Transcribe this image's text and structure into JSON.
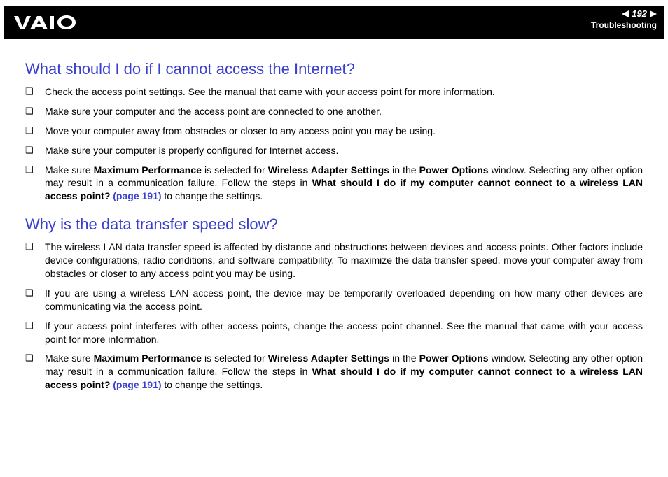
{
  "header": {
    "page_number": "192",
    "section": "Troubleshooting"
  },
  "section1": {
    "heading": "What should I do if I cannot access the Internet?",
    "items": [
      {
        "text": "Check the access point settings. See the manual that came with your access point for more information."
      },
      {
        "text": "Make sure your computer and the access point are connected to one another."
      },
      {
        "text": "Move your computer away from obstacles or closer to any access point you may be using."
      },
      {
        "text": "Make sure your computer is properly configured for Internet access."
      }
    ],
    "item5": {
      "p1": "Make sure ",
      "b1": "Maximum Performance",
      "p2": " is selected for ",
      "b2": "Wireless Adapter Settings",
      "p3": " in the ",
      "b3": "Power Options",
      "p4": " window. Selecting any other option may result in a communication failure. Follow the steps in ",
      "b4": "What should I do if my computer cannot connect to a wireless LAN access point? ",
      "link": "(page 191)",
      "p5": " to change the settings."
    }
  },
  "section2": {
    "heading": "Why is the data transfer speed slow?",
    "items": [
      {
        "text": "The wireless LAN data transfer speed is affected by distance and obstructions between devices and access points. Other factors include device configurations, radio conditions, and software compatibility. To maximize the data transfer speed, move your computer away from obstacles or closer to any access point you may be using."
      },
      {
        "text": "If you are using a wireless LAN access point, the device may be temporarily overloaded depending on how many other devices are communicating via the access point."
      },
      {
        "text": "If your access point interferes with other access points, change the access point channel. See the manual that came with your access point for more information."
      }
    ],
    "item4": {
      "p1": "Make sure ",
      "b1": "Maximum Performance",
      "p2": " is selected for ",
      "b2": "Wireless Adapter Settings",
      "p3": " in the ",
      "b3": "Power Options",
      "p4": " window. Selecting any other option may result in a communication failure. Follow the steps in ",
      "b4": "What should I do if my computer cannot connect to a wireless LAN access point? ",
      "link": "(page 191)",
      "p5": " to change the settings."
    }
  }
}
